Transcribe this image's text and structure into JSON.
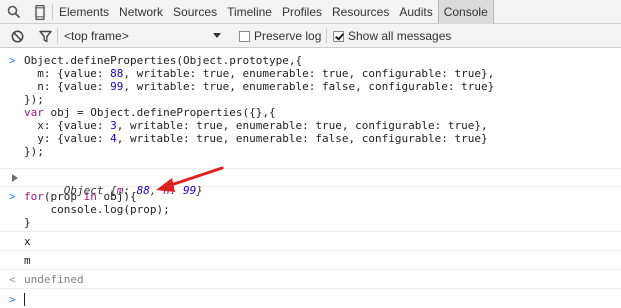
{
  "tabbar": {
    "icons": [
      "search-icon",
      "device-mode-icon"
    ],
    "tabs": [
      "Elements",
      "Network",
      "Sources",
      "Timeline",
      "Profiles",
      "Resources",
      "Audits",
      "Console"
    ],
    "active_tab": "Console"
  },
  "toolbar": {
    "icons": [
      "clear-console-icon",
      "filter-icon"
    ],
    "frame_select": "<top frame>",
    "preserve_log": {
      "label": "Preserve log",
      "checked": false
    },
    "show_all_messages": {
      "label": "Show all messages",
      "checked": true
    }
  },
  "console": {
    "entry1_lines": [
      "Object.defineProperties(Object.prototype,{",
      "  m: {value: 88, writable: true, enumerable: true, configurable: true},",
      "  n: {value: 99, writable: true, enumerable: false, configurable: true}",
      "});",
      "var obj = Object.defineProperties({},{",
      "  x: {value: 3, writable: true, enumerable: true, configurable: true},",
      "  y: {value: 4, writable: true, enumerable: false, configurable: true}",
      "});"
    ],
    "entry1_result": {
      "label": "Object",
      "props": [
        {
          "key": "m",
          "value": "88"
        },
        {
          "key": "n",
          "value": "99"
        }
      ]
    },
    "entry2_lines": [
      "for(prop in obj){",
      "    console.log(prop);",
      "}"
    ],
    "log_outputs": [
      "x",
      "m"
    ],
    "entry2_result": "undefined",
    "prompt_symbol": ">",
    "result_symbol": "<"
  },
  "colors": {
    "annotation_arrow": "#e02020",
    "keyword": "#aa0d91",
    "number": "#1c00cf",
    "prompt": "#367cf1"
  }
}
